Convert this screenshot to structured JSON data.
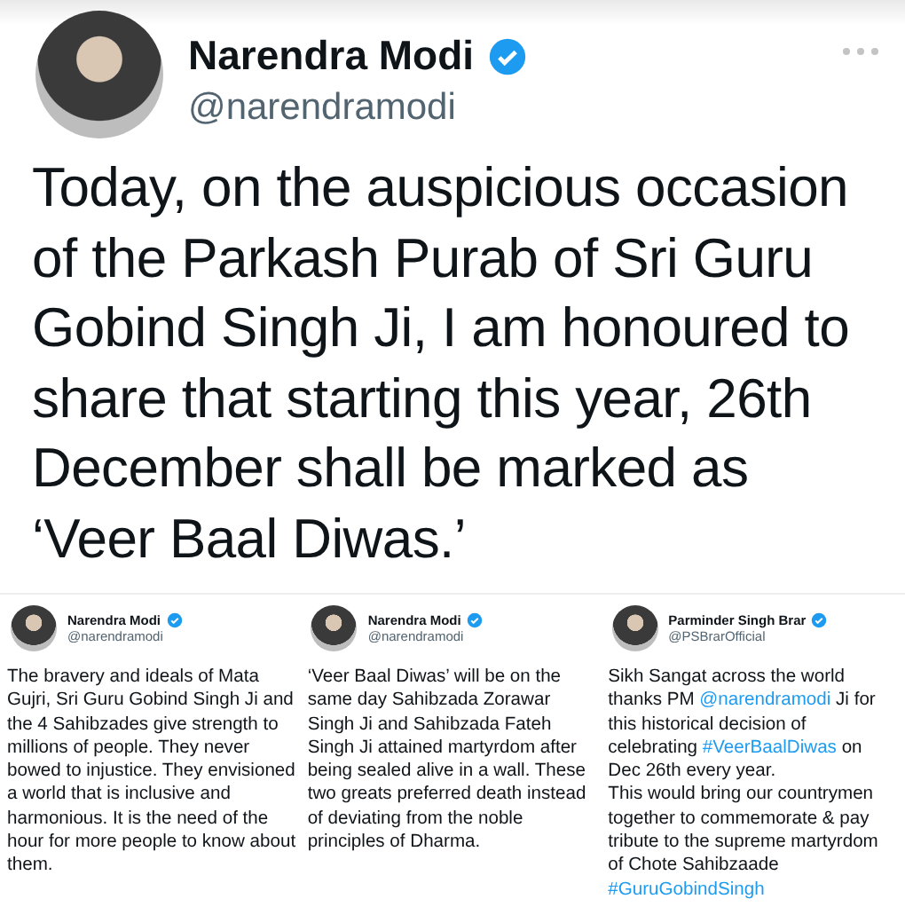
{
  "main_tweet": {
    "name": "Narendra Modi",
    "handle": "@narendramodi",
    "verified": true,
    "text": "Today, on the auspicious occasion of the Parkash Purab of Sri Guru Gobind Singh Ji, I am honoured to share that starting this year, 26th December shall be marked as ‘Veer Baal Diwas.’"
  },
  "tweets": [
    {
      "name": "Narendra Modi",
      "handle": "@narendramodi",
      "verified": true,
      "paragraphs": [
        [
          {
            "kind": "text",
            "text": "The bravery and ideals of Mata Gujri, Sri Guru Gobind Singh Ji and the 4 Sahibzades give strength to millions of people. They never bowed to injustice. They envisioned a world that is inclusive and harmonious. It is the need of the hour for more people to know about them."
          }
        ]
      ]
    },
    {
      "name": "Narendra Modi",
      "handle": "@narendramodi",
      "verified": true,
      "paragraphs": [
        [
          {
            "kind": "text",
            "text": "‘Veer Baal Diwas’ will be on the same day Sahibzada Zorawar Singh Ji and Sahibzada Fateh Singh Ji attained martyrdom after being sealed alive in a wall. These two greats preferred death instead of deviating from the noble principles of Dharma."
          }
        ]
      ]
    },
    {
      "name": "Parminder Singh Brar",
      "handle": "@PSBrarOfficial",
      "verified": true,
      "paragraphs": [
        [
          {
            "kind": "text",
            "text": "Sikh Sangat across the world thanks PM "
          },
          {
            "kind": "link",
            "text": "@narendramodi"
          },
          {
            "kind": "text",
            "text": " Ji for this historical decision of celebrating "
          },
          {
            "kind": "link",
            "text": "#VeerBaalDiwas"
          },
          {
            "kind": "text",
            "text": " on Dec 26th every year."
          }
        ],
        [
          {
            "kind": "text",
            "text": "This would bring our countrymen together to commemorate & pay tribute to the supreme martyrdom of Chote Sahibzaade "
          },
          {
            "kind": "link",
            "text": "#GuruGobindSingh"
          }
        ]
      ]
    }
  ]
}
